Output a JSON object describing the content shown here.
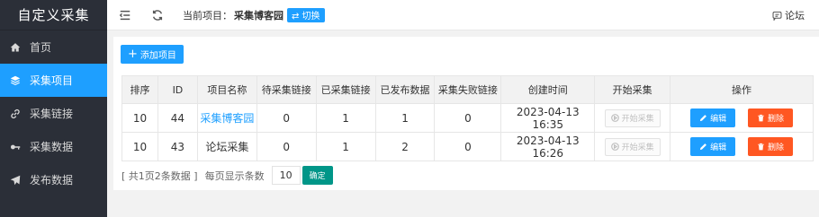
{
  "sidebar": {
    "brand": "自定义采集",
    "items": [
      {
        "label": "首页",
        "icon": "home-icon"
      },
      {
        "label": "采集项目",
        "icon": "layers-icon",
        "active": true
      },
      {
        "label": "采集链接",
        "icon": "link-icon"
      },
      {
        "label": "采集数据",
        "icon": "key-icon"
      },
      {
        "label": "发布数据",
        "icon": "send-icon"
      }
    ]
  },
  "topbar": {
    "current_label": "当前项目：",
    "current_name": "采集博客园",
    "switch_label": "⇄ 切换",
    "forum_label": "论坛"
  },
  "toolbar": {
    "add_label": "添加项目"
  },
  "table": {
    "headers": [
      "排序",
      "ID",
      "项目名称",
      "待采集链接",
      "已采集链接",
      "已发布数据",
      "采集失败链接",
      "创建时间",
      "开始采集",
      "操作"
    ],
    "rows": [
      {
        "sort": "10",
        "id": "44",
        "name": "采集博客园",
        "pending": "0",
        "collected": "1",
        "published": "1",
        "failed": "0",
        "created": "2023-04-13 16:35",
        "start": "开始采集",
        "edit": "编辑",
        "delete": "删除"
      },
      {
        "sort": "10",
        "id": "43",
        "name": "论坛采集",
        "pending": "0",
        "collected": "1",
        "published": "2",
        "failed": "0",
        "created": "2023-04-13 16:26",
        "start": "开始采集",
        "edit": "编辑",
        "delete": "删除"
      }
    ]
  },
  "pager": {
    "summary": "[ 共1页2条数据 ]",
    "page_size_label": "每页显示条数",
    "page_size_value": "10",
    "confirm_label": "确定"
  },
  "colors": {
    "sidebar_bg": "#2b2f38",
    "accent": "#1e9fff",
    "danger": "#ff5722",
    "confirm": "#009688"
  }
}
